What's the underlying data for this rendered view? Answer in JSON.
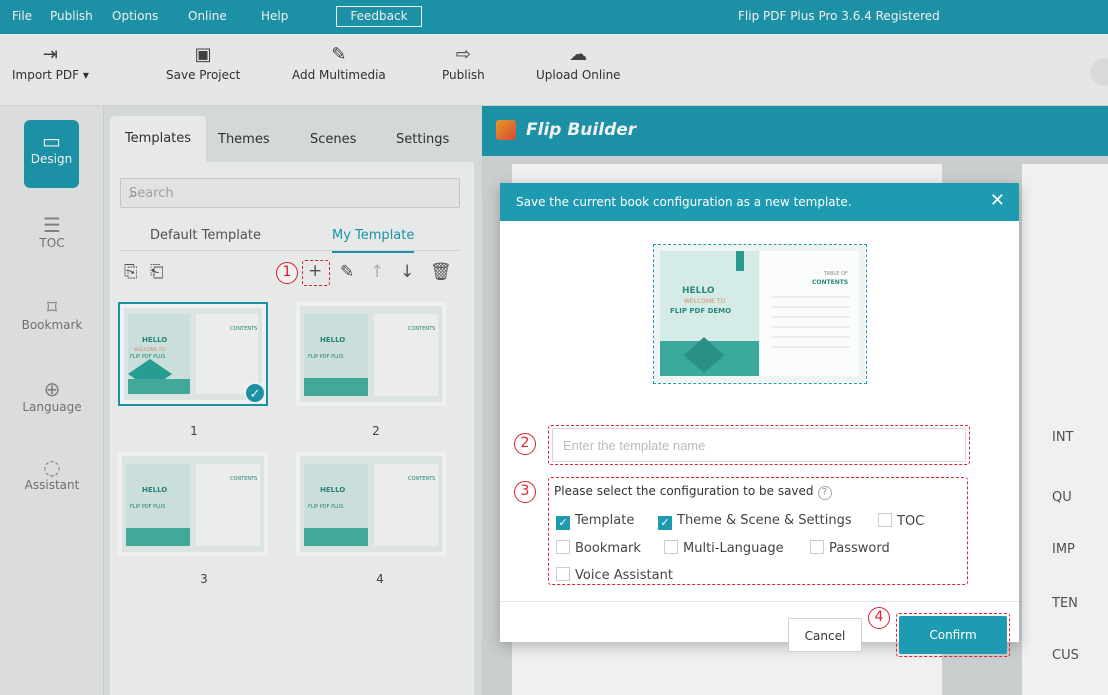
{
  "menu": {
    "items": [
      "File",
      "Publish",
      "Options",
      "Online",
      "Help"
    ],
    "feedback": "Feedback",
    "app_title": "Flip PDF Plus Pro 3.6.4 Registered"
  },
  "toolbar": {
    "import": "Import PDF ▾",
    "save": "Save Project",
    "multimedia": "Add Multimedia",
    "publish": "Publish",
    "upload": "Upload Online"
  },
  "nav": {
    "design": "Design",
    "toc": "TOC",
    "bookmark": "Bookmark",
    "language": "Language",
    "assistant": "Assistant"
  },
  "panel": {
    "tabs": [
      "Templates",
      "Themes",
      "Scenes",
      "Settings"
    ],
    "search_placeholder": "Search",
    "subtabs": [
      "Default Template",
      "My Template"
    ],
    "thumb_labels": [
      "1",
      "2",
      "3",
      "4"
    ]
  },
  "stage": {
    "brand": "Flip Builder",
    "side_items": [
      "INT",
      "QU",
      "IMP",
      "TEN",
      "CUS"
    ]
  },
  "thumb": {
    "hello": "HELLO",
    "welcome": "WELCOME TO",
    "plus": "FLIP PDF PLUS",
    "demo": "FLIP PDF DEMO",
    "contents": "CONTENTS",
    "table_of": "TABLE OF"
  },
  "dialog": {
    "title": "Save the current book configuration as a new template.",
    "name_placeholder": "Enter the template name",
    "config_label": "Please select the configuration to be saved",
    "options": [
      {
        "label": "Template",
        "checked": true
      },
      {
        "label": "Theme & Scene & Settings",
        "checked": true
      },
      {
        "label": "TOC",
        "checked": false
      },
      {
        "label": "Bookmark",
        "checked": false
      },
      {
        "label": "Multi-Language",
        "checked": false
      },
      {
        "label": "Password",
        "checked": false
      },
      {
        "label": "Voice Assistant",
        "checked": false
      }
    ],
    "cancel": "Cancel",
    "confirm": "Confirm"
  },
  "steps": [
    "1",
    "2",
    "3",
    "4"
  ],
  "colors": {
    "accent": "#1e9bb0",
    "annotation": "#dd2233"
  }
}
